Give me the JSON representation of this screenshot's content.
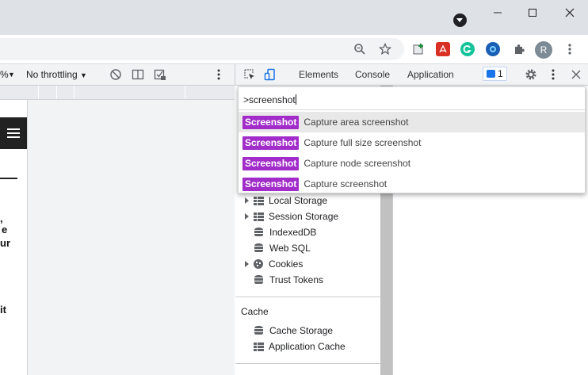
{
  "window": {
    "controls": [
      "minimize",
      "maximize",
      "close"
    ]
  },
  "device_toolbar": {
    "zoom_fragment": "%",
    "throttling_label": "No throttling"
  },
  "page_text": {
    "line1": ",",
    "line2": "e",
    "line3": "ur",
    "line4": "it"
  },
  "devtools": {
    "tabs": [
      "Elements",
      "Console",
      "Application"
    ],
    "issues_count": "1"
  },
  "command_menu": {
    "query": ">screenshot",
    "items": [
      {
        "badge": "Screenshot",
        "label": "Capture area screenshot"
      },
      {
        "badge": "Screenshot",
        "label": "Capture full size screenshot"
      },
      {
        "badge": "Screenshot",
        "label": "Capture node screenshot"
      },
      {
        "badge": "Screenshot",
        "label": "Capture screenshot"
      }
    ]
  },
  "storage_tree": {
    "items": [
      "Local Storage",
      "Session Storage",
      "IndexedDB",
      "Web SQL",
      "Cookies",
      "Trust Tokens"
    ]
  },
  "cache_section": {
    "title": "Cache",
    "items": [
      "Cache Storage",
      "Application Cache"
    ]
  },
  "colors": {
    "badge": "#a12cc9",
    "accent": "#1a73e8"
  }
}
